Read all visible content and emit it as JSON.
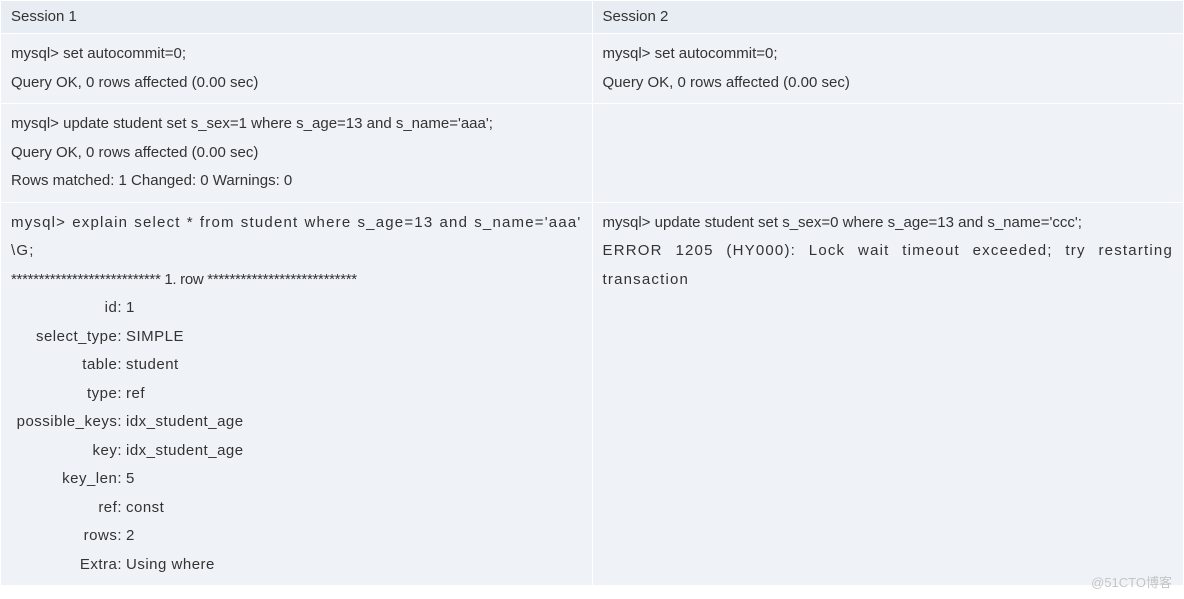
{
  "headers": {
    "session1": "Session 1",
    "session2": "Session 2"
  },
  "row1": {
    "s1_line1": "mysql> set autocommit=0;",
    "s1_line2": "Query OK, 0 rows affected (0.00 sec)",
    "s2_line1": "mysql> set autocommit=0;",
    "s2_line2": "Query OK, 0 rows affected (0.00 sec)"
  },
  "row2": {
    "s1_line1": "mysql> update student set s_sex=1 where s_age=13 and s_name='aaa';",
    "s1_line2": "Query OK, 0 rows affected (0.00 sec)",
    "s1_line3": "Rows matched: 1  Changed: 0  Warnings: 0"
  },
  "row3": {
    "s1_cmd": "mysql> explain select * from student where s_age=13 and s_name='aaa' \\G;",
    "s1_stars": "*************************** 1. row ***************************",
    "explain": {
      "id_label": "id:",
      "id_val": " 1",
      "select_type_label": "select_type:",
      "select_type_val": " SIMPLE",
      "table_label": "table:",
      "table_val": " student",
      "type_label": "type:",
      "type_val": " ref",
      "possible_keys_label": "possible_keys:",
      "possible_keys_val": " idx_student_age",
      "key_label": "key:",
      "key_val": " idx_student_age",
      "key_len_label": "key_len:",
      "key_len_val": " 5",
      "ref_label": "ref:",
      "ref_val": " const",
      "rows_label": "rows:",
      "rows_val": " 2",
      "extra_label": "Extra:",
      "extra_val": " Using where"
    },
    "s2_line1": "mysql> update student set s_sex=0 where s_age=13 and s_name='ccc';",
    "s2_line2": "ERROR 1205 (HY000): Lock wait timeout exceeded; try restarting transaction"
  },
  "watermark": "@51CTO博客"
}
